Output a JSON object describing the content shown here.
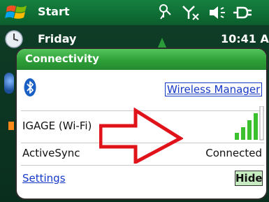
{
  "taskbar": {
    "start_label": "Start",
    "icons": [
      "connectivity-icon",
      "no-signal-icon",
      "volume-icon",
      "battery-icon"
    ]
  },
  "today": {
    "day": "Friday",
    "time": "10:41 AM"
  },
  "connectivity_popup": {
    "title": "Connectivity",
    "bluetooth_icon": "bluetooth-icon",
    "wireless_manager_link": "Wireless Manager",
    "wifi": {
      "network_name": "IGAGE (Wi-Fi)",
      "signal_icon": "wifi-signal-bars-icon"
    },
    "activesync": {
      "label": "ActiveSync",
      "status": "Connected"
    },
    "settings_link": "Settings",
    "hide_button": "Hide"
  },
  "colors": {
    "taskbar_green": "#16803f",
    "header_green": "#2e9f38",
    "link_blue": "#1538c8",
    "arrow_red": "#e0131a",
    "signal_green": "#3cc12e"
  }
}
